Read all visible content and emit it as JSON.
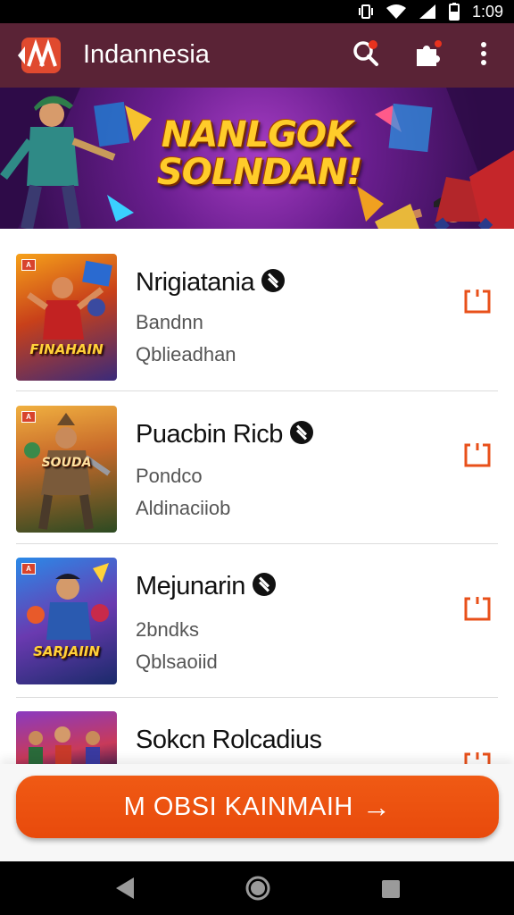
{
  "status_bar": {
    "time": "1:09",
    "icons": [
      "vibrate-icon",
      "wifi-icon",
      "signal-icon",
      "battery-icon"
    ]
  },
  "app_bar": {
    "title": "Indannesia",
    "logo_text": "",
    "actions": [
      "search-icon",
      "puzzle-icon",
      "more-vert-icon"
    ],
    "notification_badge": "",
    "colors": {
      "background": "#5a2336",
      "logo": "#e04a2f"
    }
  },
  "banner": {
    "line1": "NANLGOK",
    "line2": "SOLNDAN!"
  },
  "items": [
    {
      "title": "Nrigiatania",
      "sub1": "Bandnn",
      "sub2": "Qblieadhan",
      "thumb_caption": "FINAHAIN",
      "verified": true
    },
    {
      "title": "Puacbin Ricb",
      "sub1": "Pondco",
      "sub2": "Aldinaciiob",
      "thumb_caption": "SOUDA",
      "verified": true
    },
    {
      "title": "Mejunarin",
      "sub1": "2bndks",
      "sub2": "Qblsaoiid",
      "thumb_caption": "SARJAIIN",
      "verified": true
    },
    {
      "title": "Sokcn Rolcadius",
      "sub1": "",
      "sub2": "",
      "thumb_caption": "",
      "verified": false
    }
  ],
  "cta": {
    "label": "M OBSI KAINMAIH",
    "arrow": "→",
    "color": "#ee5410"
  },
  "nav_bar": [
    "back-icon",
    "home-icon",
    "recents-icon"
  ],
  "accent_color": "#e8501a"
}
